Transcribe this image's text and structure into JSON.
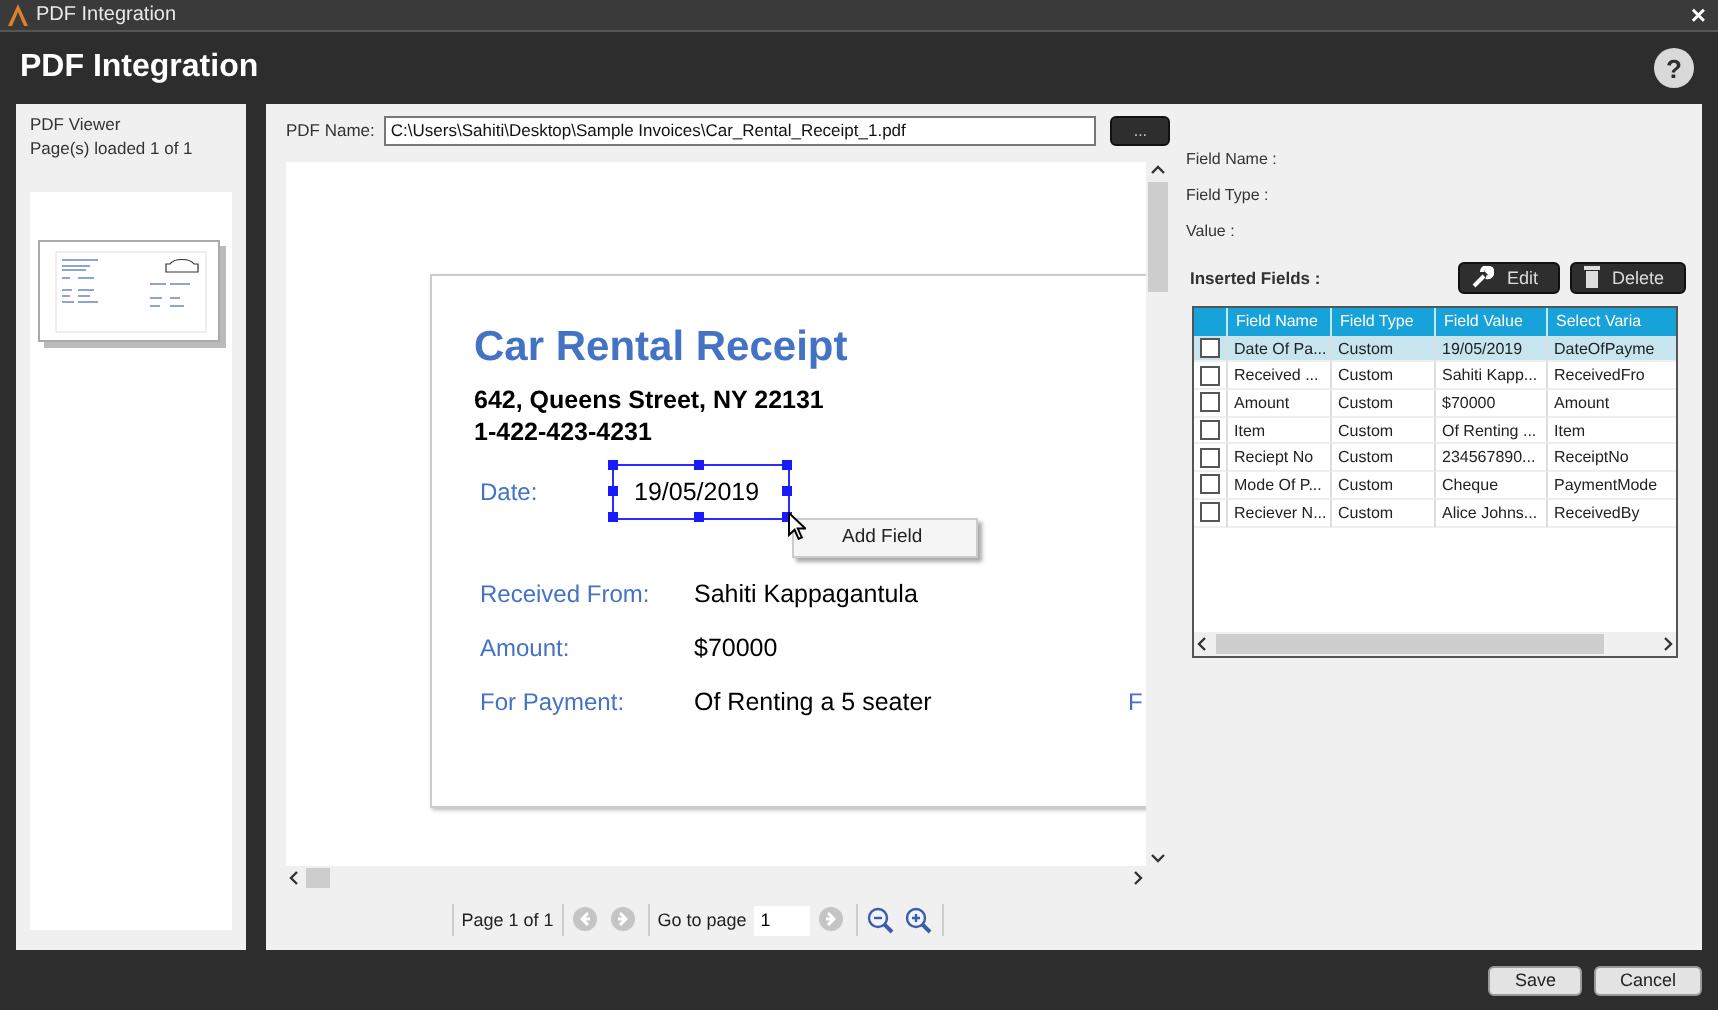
{
  "window": {
    "title": "PDF Integration",
    "close": "×"
  },
  "header": {
    "title": "PDF Integration",
    "help": "?"
  },
  "viewer_panel": {
    "title": "PDF Viewer",
    "pages_loaded": "Page(s) loaded 1 of 1"
  },
  "pdf_name": {
    "label": "PDF Name:",
    "value": "C:\\Users\\Sahiti\\Desktop\\Sample Invoices\\Car_Rental_Receipt_1.pdf",
    "browse": "..."
  },
  "document": {
    "title": "Car Rental Receipt",
    "address": "642, Queens Street, NY 22131",
    "phone": "1-422-423-4231",
    "rows": [
      {
        "label": "Date:",
        "value": "19/05/2019",
        "selected": true
      },
      {
        "label": "Received From:",
        "value": "Sahiti Kappagantula",
        "selected": false
      },
      {
        "label": "Amount:",
        "value": "$70000",
        "selected": false
      },
      {
        "label": "For Payment:",
        "value": "Of Renting a 5 seater",
        "selected": false
      }
    ],
    "cut_text": "F"
  },
  "context_menu": {
    "items": [
      "Add Field"
    ]
  },
  "pagination": {
    "page": "Page 1 of 1",
    "go_to": "Go to page",
    "page_input": "1"
  },
  "field_details": [
    {
      "label": "Field Name :"
    },
    {
      "label": "Field Type :"
    },
    {
      "label": "Value :"
    }
  ],
  "inserted_fields": {
    "title": "Inserted Fields :",
    "edit": "Edit",
    "delete": "Delete",
    "columns": [
      "Field Name",
      "Field Type",
      "Field Value",
      "Select Varia"
    ],
    "rows": [
      {
        "cells": [
          "Date Of Pa...",
          "Custom",
          "19/05/2019",
          "DateOfPayme"
        ],
        "selected": true,
        "checked": false
      },
      {
        "cells": [
          "Received ...",
          "Custom",
          "Sahiti Kapp...",
          "ReceivedFro"
        ],
        "selected": false,
        "checked": false
      },
      {
        "cells": [
          "Amount",
          "Custom",
          "$70000",
          "Amount"
        ],
        "selected": false,
        "checked": false
      },
      {
        "cells": [
          "Item",
          "Custom",
          "Of Renting ...",
          "Item"
        ],
        "selected": false,
        "checked": false
      },
      {
        "cells": [
          "Reciept No",
          "Custom",
          "234567890...",
          "ReceiptNo"
        ],
        "selected": false,
        "checked": false
      },
      {
        "cells": [
          "Mode Of P...",
          "Custom",
          "Cheque",
          "PaymentMode"
        ],
        "selected": false,
        "checked": false
      },
      {
        "cells": [
          "Reciever N...",
          "Custom",
          "Alice Johns...",
          "ReceivedBy"
        ],
        "selected": false,
        "checked": false
      }
    ]
  },
  "buttons": [
    "Save",
    "Cancel"
  ]
}
